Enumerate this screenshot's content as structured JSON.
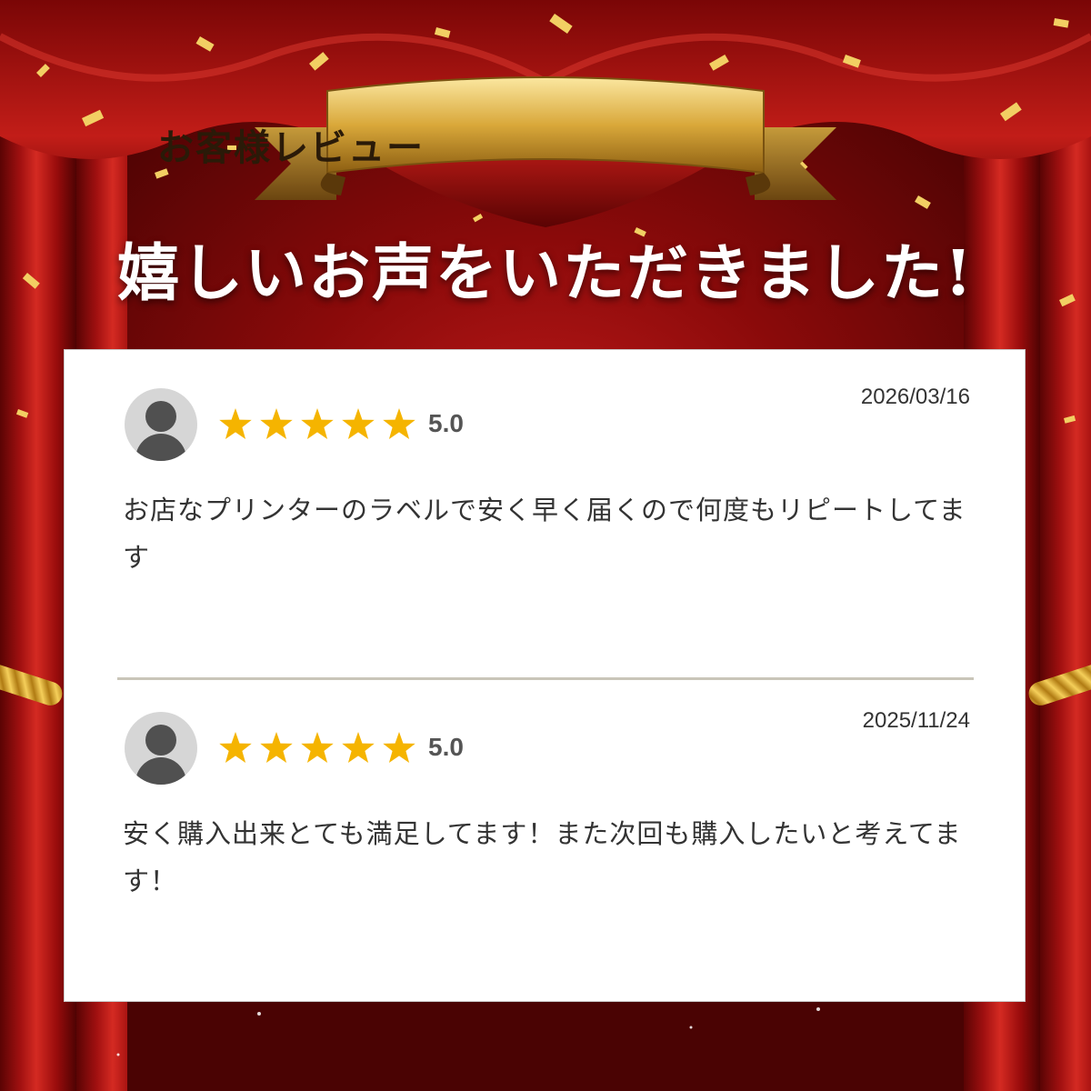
{
  "banner": {
    "title": "お客様レビュー"
  },
  "headline": "嬉しいお声をいただきました!",
  "reviews": [
    {
      "date": "2026/03/16",
      "stars": 5,
      "rating": "5.0",
      "body": "お店なプリンターのラベルで安く早く届くので何度もリピートしてます"
    },
    {
      "date": "2025/11/24",
      "stars": 5,
      "rating": "5.0",
      "body": "安く購入出来とても満足してます！また次回も購入したいと考えてます！"
    }
  ],
  "colors": {
    "curtain": "#a01010",
    "gold": "#d9b04a",
    "star": "#f5b400",
    "card": "#ffffff",
    "avatar_bg": "#d6d6d6",
    "avatar_fg": "#505050"
  },
  "icons": [
    "avatar-icon",
    "star-icon"
  ]
}
